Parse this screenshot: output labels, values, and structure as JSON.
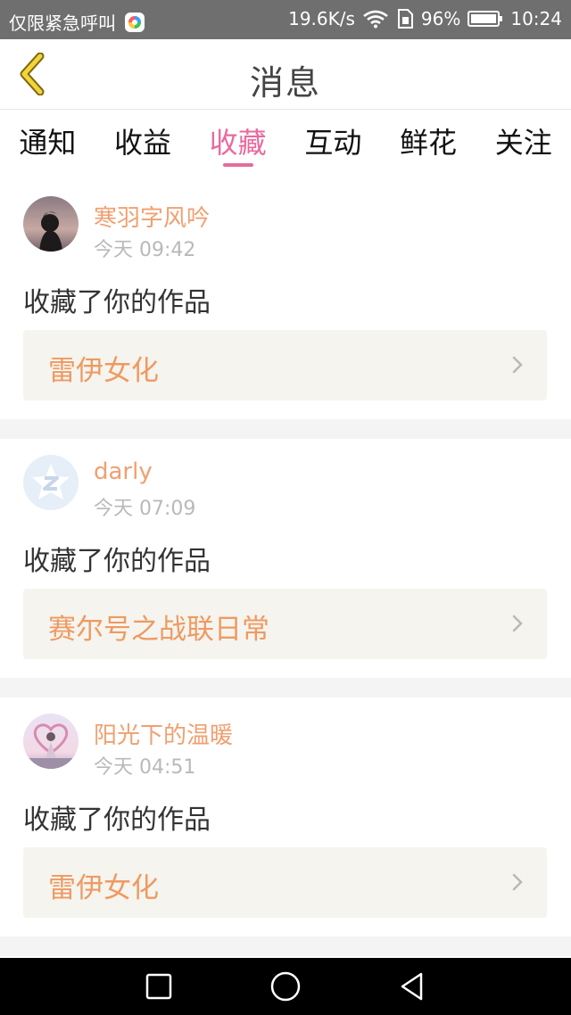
{
  "status_bar": {
    "carrier_text": "仅限紧急呼叫",
    "network_speed": "19.6K/s",
    "battery_percent": "96%",
    "time": "10:24"
  },
  "header": {
    "title": "消息",
    "back_icon": "chevron-left-icon"
  },
  "tabs": [
    {
      "label": "通知",
      "active": false
    },
    {
      "label": "收益",
      "active": false
    },
    {
      "label": "收藏",
      "active": true
    },
    {
      "label": "互动",
      "active": false
    },
    {
      "label": "鲜花",
      "active": false
    },
    {
      "label": "关注",
      "active": false
    }
  ],
  "messages": [
    {
      "username": "寒羽字风吟",
      "time": "今天 09:42",
      "action": "收藏了你的作品",
      "work_title": "雷伊女化"
    },
    {
      "username": "darly",
      "time": "今天 07:09",
      "action": "收藏了你的作品",
      "work_title": "赛尔号之战联日常"
    },
    {
      "username": "阳光下的温暖",
      "time": "今天 04:51",
      "action": "收藏了你的作品",
      "work_title": "雷伊女化"
    }
  ],
  "colors": {
    "accent": "#e96a9e",
    "username": "#f0a070",
    "work_title": "#ee9a62",
    "work_bg": "#f5f4ee",
    "status_bar_bg": "#6f6f6f"
  },
  "nav_bar": {
    "icons": [
      "square-recents-icon",
      "circle-home-icon",
      "triangle-back-icon"
    ]
  }
}
